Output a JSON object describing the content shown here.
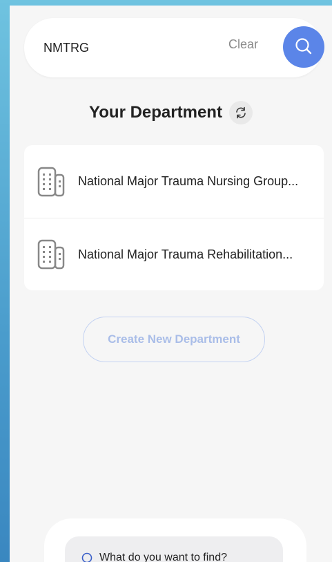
{
  "search": {
    "value": "NMTRG",
    "clear_label": "Clear"
  },
  "department": {
    "title": "Your Department"
  },
  "departments": [
    {
      "name": "National Major Trauma Nursing Group..."
    },
    {
      "name": "National Major Trauma Rehabilitation..."
    }
  ],
  "create_button": {
    "label": "Create New Department"
  },
  "find": {
    "placeholder": "What do you want to find?"
  },
  "colors": {
    "accent": "#5b85e8",
    "create_text": "#a9bde8",
    "background": "#f6f6f6"
  },
  "icons": {
    "search": "search-icon",
    "refresh": "refresh-icon",
    "building": "building-icon"
  }
}
